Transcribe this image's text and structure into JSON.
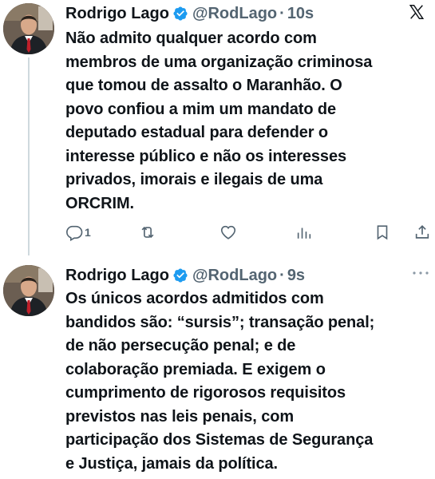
{
  "tweets": [
    {
      "author_name": "Rodrigo Lago",
      "handle": "@RodLago",
      "separator": "·",
      "time": "10s",
      "lines": [
        "Não admito qualquer acordo com",
        "membros de uma organização criminosa",
        "que tomou de assalto o Maranhão. O",
        "povo confiou a mim um mandato de",
        "deputado estadual para defender o",
        "interesse público e não os interesses",
        "privados, imorais e ilegais de uma",
        "ORCRIM."
      ],
      "reply_count": "1"
    },
    {
      "author_name": "Rodrigo Lago",
      "handle": "@RodLago",
      "separator": "·",
      "time": "9s",
      "lines": [
        "Os únicos acordos admitidos com",
        "bandidos são: “sursis”; transação penal;",
        "de não persecução penal; e de",
        "colaboração premiada. E exigem o",
        "cumprimento de rigorosos requisitos",
        "previstos nas leis penais, com",
        "participação dos Sistemas de Segurança",
        "e Justiça, jamais da política."
      ]
    }
  ],
  "icons": {
    "verified": "verified-badge-icon",
    "platform": "x-logo-icon",
    "more": "more-icon",
    "reply": "reply-icon",
    "retweet": "retweet-icon",
    "like": "like-icon",
    "views": "views-icon",
    "bookmark": "bookmark-icon",
    "share": "share-icon"
  },
  "colors": {
    "text": "#0f1419",
    "secondary": "#536471",
    "verified": "#1d9bf0",
    "thread_line": "#cfd9de"
  }
}
